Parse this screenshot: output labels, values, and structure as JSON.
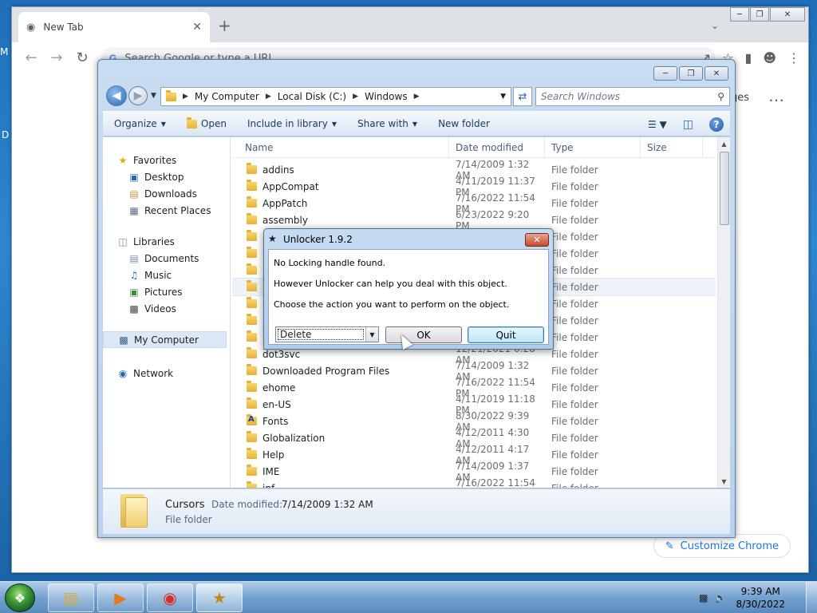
{
  "desktop": {
    "left_frag_top": "M",
    "left_frag_mid": "D"
  },
  "chrome": {
    "tab_title": "New Tab",
    "omnibox_placeholder": "Search Google or type a URL",
    "ntp_partial_text": "ges",
    "customize_label": "Customize Chrome"
  },
  "explorer": {
    "address": [
      "My Computer",
      "Local Disk (C:)",
      "Windows"
    ],
    "search_placeholder": "Search Windows",
    "commands": [
      "Organize",
      "Open",
      "Include in library",
      "Share with",
      "New folder"
    ],
    "nav": {
      "favorites": "Favorites",
      "favorites_items": [
        "Desktop",
        "Downloads",
        "Recent Places"
      ],
      "libraries": "Libraries",
      "libraries_items": [
        "Documents",
        "Music",
        "Pictures",
        "Videos"
      ],
      "computer": "My Computer",
      "network": "Network"
    },
    "columns": {
      "name": "Name",
      "date": "Date modified",
      "type": "Type",
      "size": "Size"
    },
    "files": [
      {
        "name": "addins",
        "date": "7/14/2009 1:32 AM",
        "type": "File folder"
      },
      {
        "name": "AppCompat",
        "date": "4/11/2019 11:37 PM",
        "type": "File folder"
      },
      {
        "name": "AppPatch",
        "date": "7/16/2022 11:54 PM",
        "type": "File folder"
      },
      {
        "name": "assembly",
        "date": "6/23/2022 9:20 PM",
        "type": "File folder"
      },
      {
        "name": "",
        "date": "",
        "type": "File folder"
      },
      {
        "name": "",
        "date": "",
        "type": "File folder"
      },
      {
        "name": "",
        "date": "",
        "type": "File folder"
      },
      {
        "name": "",
        "date": "",
        "type": "File folder"
      },
      {
        "name": "",
        "date": "",
        "type": "File folder"
      },
      {
        "name": "",
        "date": "",
        "type": "File folder"
      },
      {
        "name": "",
        "date": "",
        "type": "File folder"
      },
      {
        "name": "dot3svc",
        "date": "12/21/2021 6:28 AM",
        "type": "File folder"
      },
      {
        "name": "Downloaded Program Files",
        "date": "7/14/2009 1:32 AM",
        "type": "File folder"
      },
      {
        "name": "ehome",
        "date": "7/16/2022 11:54 PM",
        "type": "File folder"
      },
      {
        "name": "en-US",
        "date": "4/11/2019 11:18 PM",
        "type": "File folder"
      },
      {
        "name": "Fonts",
        "date": "8/30/2022 9:39 AM",
        "type": "File folder"
      },
      {
        "name": "Globalization",
        "date": "4/12/2011 4:30 AM",
        "type": "File folder"
      },
      {
        "name": "Help",
        "date": "4/12/2011 4:17 AM",
        "type": "File folder"
      },
      {
        "name": "IME",
        "date": "7/14/2009 1:37 AM",
        "type": "File folder"
      },
      {
        "name": "inf",
        "date": "7/16/2022 11:54 PM",
        "type": "File folder"
      }
    ],
    "details": {
      "name": "Cursors",
      "modified_label": "Date modified:",
      "modified_value": "7/14/2009 1:32 AM",
      "type": "File folder"
    }
  },
  "dialog": {
    "title": "Unlocker 1.9.2",
    "line1": "No Locking handle found.",
    "line2": "However Unlocker can help you deal with this object.",
    "line3": "Choose the action you want to perform on the object.",
    "action_selected": "Delete",
    "ok_label": "OK",
    "quit_label": "Quit"
  },
  "taskbar": {
    "time": "9:39 AM",
    "date": "8/30/2022"
  }
}
